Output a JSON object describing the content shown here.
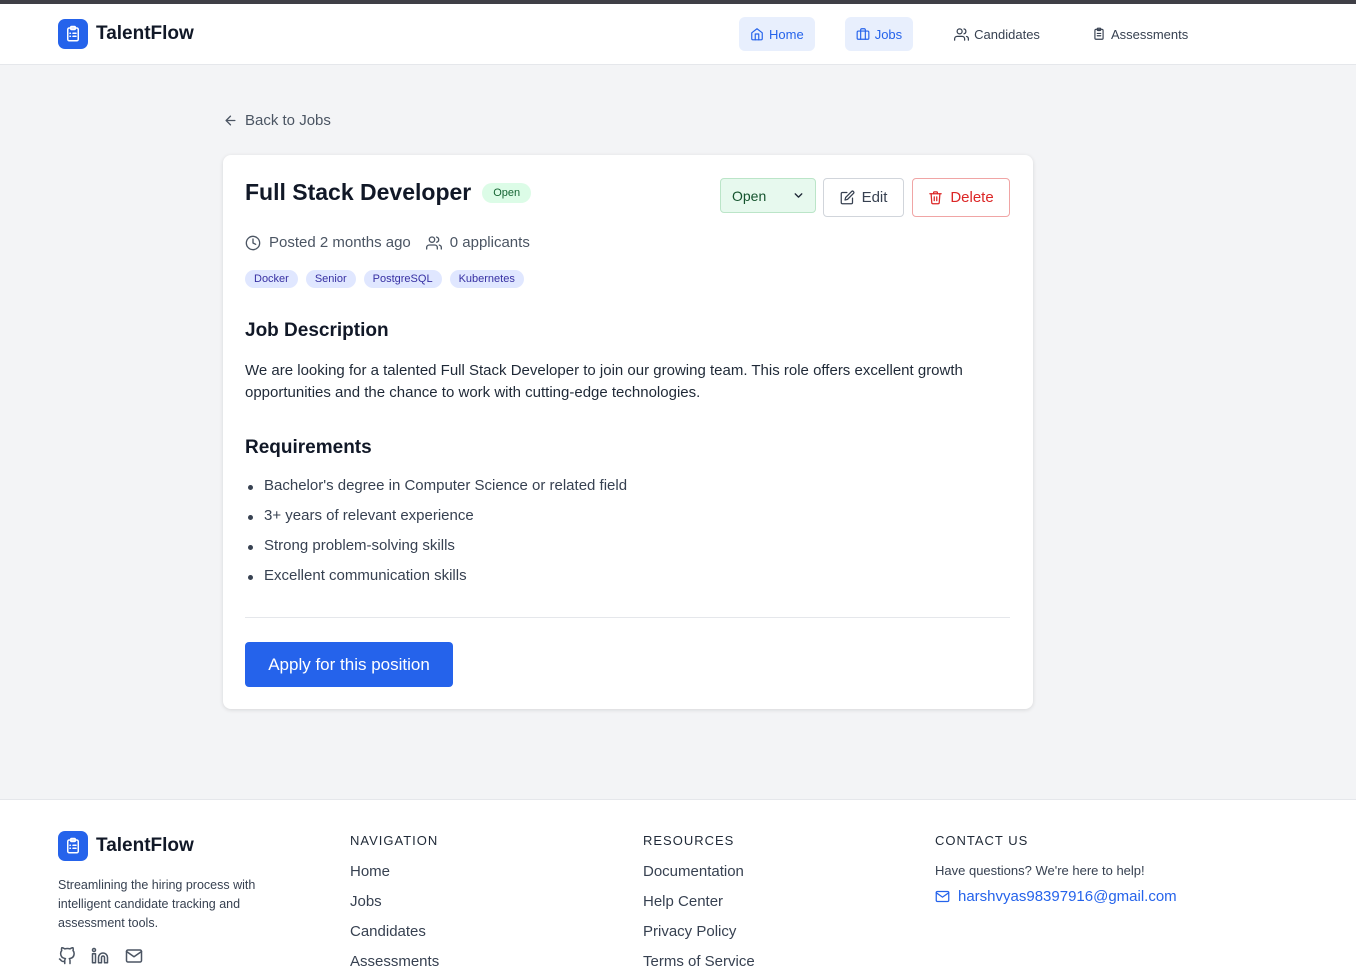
{
  "app": {
    "name": "TalentFlow"
  },
  "nav": {
    "items": [
      {
        "label": "Home",
        "icon": "home-icon",
        "active": true
      },
      {
        "label": "Jobs",
        "icon": "briefcase-icon",
        "active": true
      },
      {
        "label": "Candidates",
        "icon": "users-icon",
        "active": false
      },
      {
        "label": "Assessments",
        "icon": "clipboard-icon",
        "active": false
      }
    ]
  },
  "back_link": {
    "label": "Back to Jobs"
  },
  "job": {
    "title": "Full Stack Developer",
    "status_badge": "Open",
    "status_select_value": "Open",
    "edit_label": "Edit",
    "delete_label": "Delete",
    "posted": "Posted 2 months ago",
    "applicants": "0 applicants",
    "tags": [
      "Docker",
      "Senior",
      "PostgreSQL",
      "Kubernetes"
    ],
    "description_heading": "Job Description",
    "description": "We are looking for a talented Full Stack Developer to join our growing team. This role offers excellent growth opportunities and the chance to work with cutting-edge technologies.",
    "requirements_heading": "Requirements",
    "requirements": [
      "Bachelor's degree in Computer Science or related field",
      "3+ years of relevant experience",
      "Strong problem-solving skills",
      "Excellent communication skills"
    ],
    "apply_label": "Apply for this position"
  },
  "footer": {
    "brand": "TalentFlow",
    "tagline": "Streamlining the hiring process with intelligent candidate tracking and assessment tools.",
    "navigation": {
      "title": "NAVIGATION",
      "links": [
        "Home",
        "Jobs",
        "Candidates",
        "Assessments"
      ]
    },
    "resources": {
      "title": "RESOURCES",
      "links": [
        "Documentation",
        "Help Center",
        "Privacy Policy",
        "Terms of Service"
      ]
    },
    "contact": {
      "title": "CONTACT US",
      "text": "Have questions? We're here to help!",
      "email": "harshvyas98397916@gmail.com"
    },
    "social_icons": [
      "github-icon",
      "linkedin-icon",
      "mail-icon"
    ]
  },
  "colors": {
    "primary": "#2563eb",
    "danger": "#dc2626",
    "success_bg": "#dcfce7",
    "tag_bg": "#e0e7ff"
  }
}
